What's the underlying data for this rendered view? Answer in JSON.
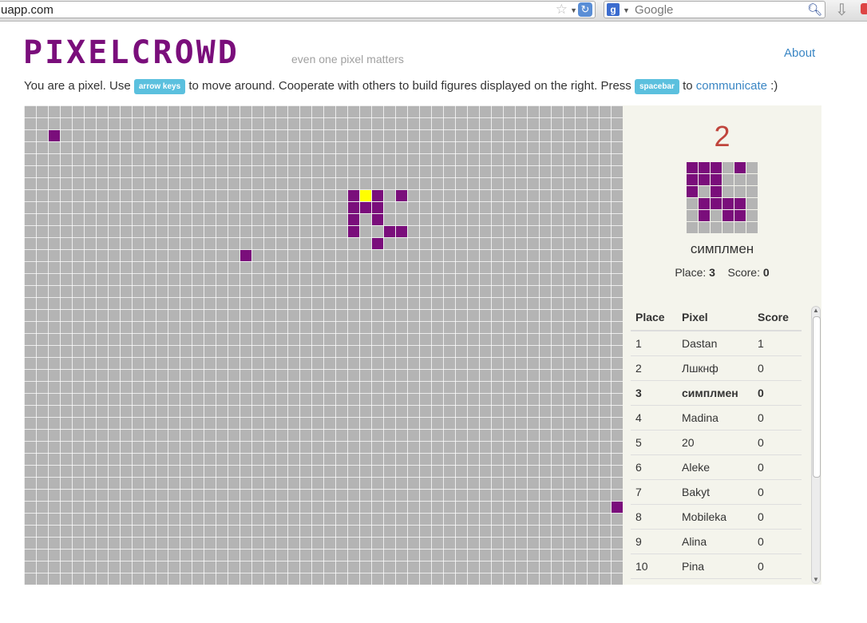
{
  "browser": {
    "url": "uapp.com",
    "search_engine_icon": "g",
    "search_placeholder": "Google"
  },
  "header": {
    "logo": "PIXELCROWD",
    "tagline": "even one pixel matters",
    "about_link": "About"
  },
  "intro": {
    "part1": "You are a pixel. Use",
    "key1": "arrow keys",
    "part2": "to move around. Cooperate with others to build figures displayed on the right. Press",
    "key2": "spacebar",
    "part3": "to",
    "link": "communicate",
    "part4": ":)"
  },
  "colors": {
    "pixel": "#7a0e7b",
    "self_pixel": "#ffff00",
    "empty": "#b4b4b4",
    "target_number": "#c0453d",
    "link": "#3a86c4"
  },
  "board": {
    "cols": 50,
    "rows": 40,
    "pixels": [
      [
        2,
        2
      ],
      [
        27,
        7
      ],
      [
        29,
        7
      ],
      [
        31,
        7
      ],
      [
        27,
        8
      ],
      [
        28,
        8
      ],
      [
        29,
        8
      ],
      [
        27,
        9
      ],
      [
        29,
        9
      ],
      [
        27,
        10
      ],
      [
        30,
        10
      ],
      [
        31,
        10
      ],
      [
        29,
        11
      ],
      [
        18,
        12
      ],
      [
        49,
        33
      ]
    ],
    "self": [
      28,
      7
    ]
  },
  "figure": {
    "number": "2",
    "size": 6,
    "filled": [
      [
        0,
        0
      ],
      [
        1,
        0
      ],
      [
        2,
        0
      ],
      [
        4,
        0
      ],
      [
        0,
        1
      ],
      [
        1,
        1
      ],
      [
        2,
        1
      ],
      [
        0,
        2
      ],
      [
        2,
        2
      ],
      [
        1,
        3
      ],
      [
        2,
        3
      ],
      [
        3,
        3
      ],
      [
        4,
        3
      ],
      [
        1,
        4
      ],
      [
        3,
        4
      ],
      [
        4,
        4
      ]
    ]
  },
  "player": {
    "name": "симплмен",
    "place_label": "Place:",
    "place": "3",
    "score_label": "Score:",
    "score": "0"
  },
  "leaderboard": {
    "headers": [
      "Place",
      "Pixel",
      "Score"
    ],
    "rows": [
      [
        "1",
        "Dastan",
        "1"
      ],
      [
        "2",
        "Лшкнф",
        "0"
      ],
      [
        "3",
        "симплмен",
        "0"
      ],
      [
        "4",
        "Madina",
        "0"
      ],
      [
        "5",
        "20",
        "0"
      ],
      [
        "6",
        "Aleke",
        "0"
      ],
      [
        "7",
        "Bakyt",
        "0"
      ],
      [
        "8",
        "Mobileka",
        "0"
      ],
      [
        "9",
        "Alina",
        "0"
      ],
      [
        "10",
        "Pina",
        "0"
      ]
    ],
    "current_index": 2
  }
}
